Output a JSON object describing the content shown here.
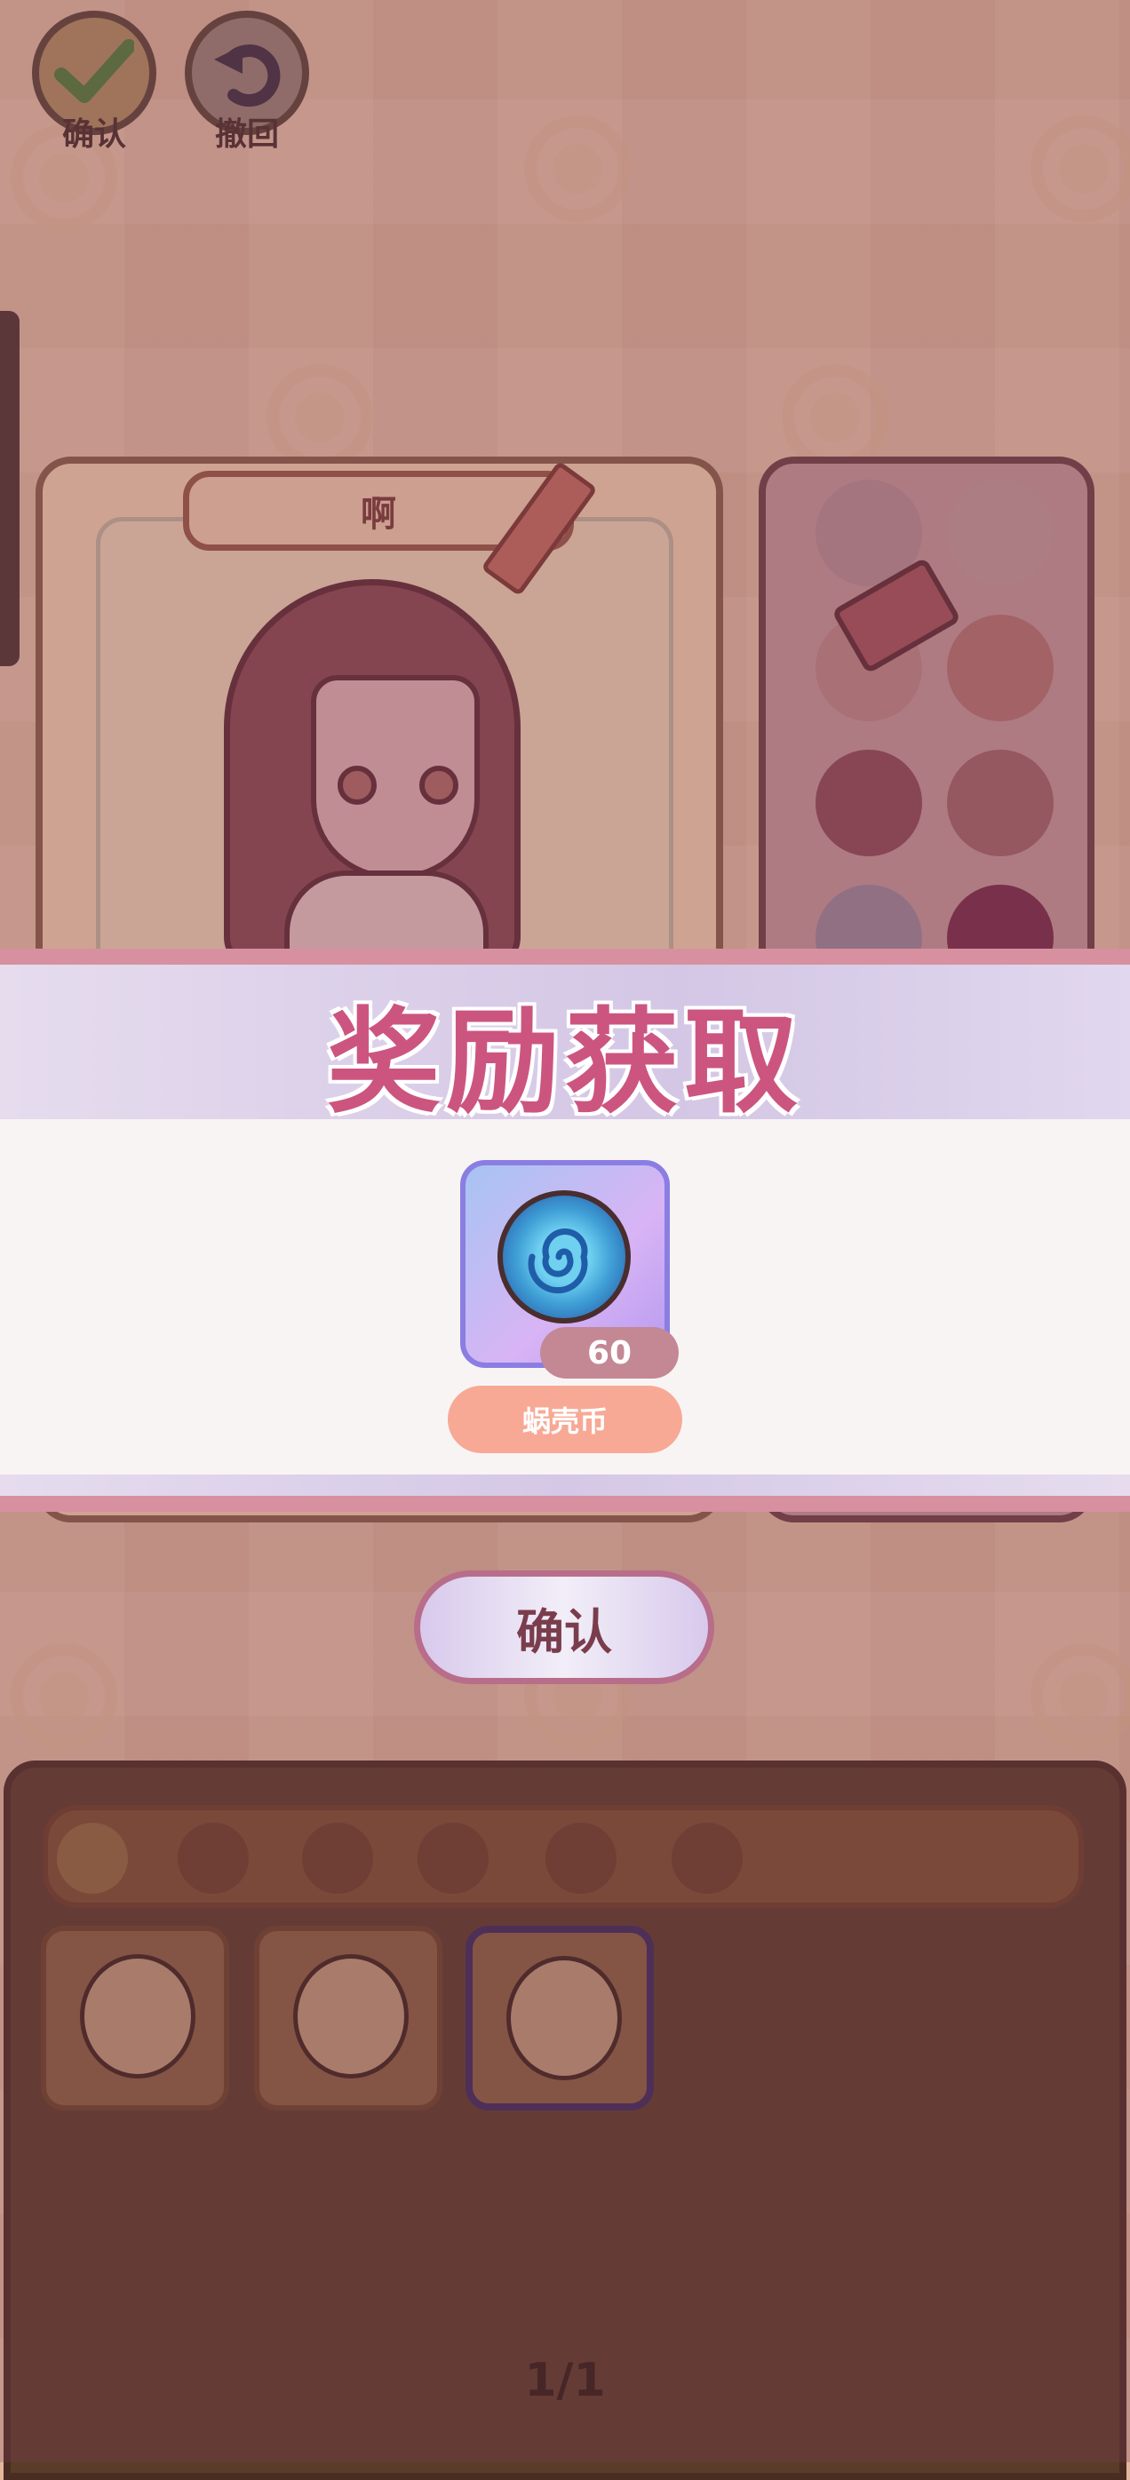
{
  "top_buttons": {
    "confirm_label": "确认",
    "undo_label": "撤回"
  },
  "character": {
    "name": "啊"
  },
  "reward_dialog": {
    "title": "奖励获取",
    "item": {
      "name": "蜗壳币",
      "quantity": "60",
      "icon": "snail-shell-coin-icon"
    },
    "confirm_label": "确认"
  },
  "bottom_panel": {
    "category_tabs": [
      "head-icon",
      "hair-icon",
      "eye-icon",
      "top-icon",
      "coat-icon",
      "shoe-icon"
    ],
    "page_indicator": "1/1"
  },
  "colors": {
    "title_pink": "#cc5580",
    "badge": "#c38894",
    "item_label_bg": "#f7a995",
    "panel_brown": "#5a3d28"
  }
}
